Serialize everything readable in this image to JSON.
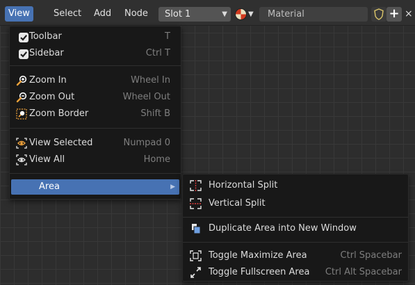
{
  "header": {
    "menus": [
      "View",
      "Select",
      "Add",
      "Node"
    ],
    "slot": "Slot 1",
    "material": "Material",
    "plus": "+",
    "close": "×"
  },
  "view_menu": {
    "items": [
      {
        "label": "Toolbar",
        "shortcut": "T",
        "icon": "checkbox-checked-icon"
      },
      {
        "label": "Sidebar",
        "shortcut": "Ctrl T",
        "icon": "checkbox-checked-icon"
      },
      {
        "label": "Zoom In",
        "shortcut": "Wheel In",
        "icon": "zoom-in-icon"
      },
      {
        "label": "Zoom Out",
        "shortcut": "Wheel Out",
        "icon": "zoom-out-icon"
      },
      {
        "label": "Zoom Border",
        "shortcut": "Shift B",
        "icon": "zoom-border-icon"
      },
      {
        "label": "View Selected",
        "shortcut": "Numpad 0",
        "icon": "view-selected-icon"
      },
      {
        "label": "View All",
        "shortcut": "Home",
        "icon": "view-all-icon"
      },
      {
        "label": "Area",
        "shortcut": "",
        "icon": "submenu-arrow-icon"
      }
    ]
  },
  "area_menu": {
    "items": [
      {
        "label": "Horizontal Split",
        "shortcut": "",
        "icon": "horizontal-split-icon"
      },
      {
        "label": "Vertical Split",
        "shortcut": "",
        "icon": "vertical-split-icon"
      },
      {
        "label": "Duplicate Area into New Window",
        "shortcut": "",
        "icon": "duplicate-window-icon"
      },
      {
        "label": "Toggle Maximize Area",
        "shortcut": "Ctrl Spacebar",
        "icon": "maximize-icon"
      },
      {
        "label": "Toggle Fullscreen Area",
        "shortcut": "Ctrl Alt Spacebar",
        "icon": "fullscreen-icon"
      }
    ]
  },
  "colors": {
    "accent": "#4772b3",
    "menu_bg": "#181818",
    "header_bg": "#303030",
    "zoom_icon_orange": "#f0a23a",
    "split_icon_red": "#e03a3a"
  }
}
